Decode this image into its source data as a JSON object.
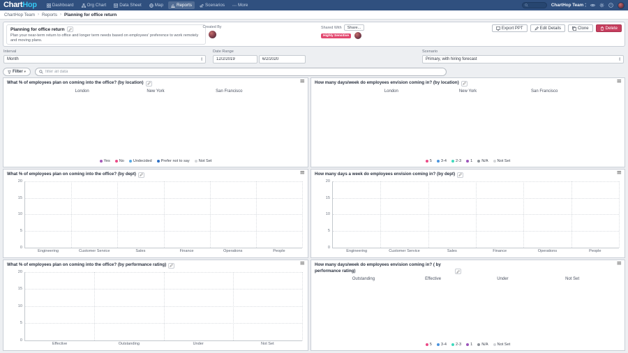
{
  "nav": {
    "logo_chart": "Chart",
    "logo_hop": "Hop",
    "items": [
      {
        "label": "Dashboard",
        "icon": "dashboard-icon"
      },
      {
        "label": "Org Chart",
        "icon": "org-chart-icon"
      },
      {
        "label": "Data Sheet",
        "icon": "data-sheet-icon"
      },
      {
        "label": "Map",
        "icon": "map-icon"
      },
      {
        "label": "Reports",
        "icon": "reports-icon"
      },
      {
        "label": "Scenarios",
        "icon": "scenarios-icon"
      },
      {
        "label": "More",
        "icon": "more-icon"
      }
    ],
    "active_item": "Reports",
    "team_name": "ChartHop Team",
    "right_icons": [
      "eye-icon",
      "gear-icon",
      "help-icon"
    ]
  },
  "breadcrumb": {
    "items": [
      "ChartHop Team",
      "Reports",
      "Planning for office return"
    ],
    "separator": "›"
  },
  "header": {
    "title": "Planning for office return",
    "description": "Plan your near-term return to office and longer term needs based on employees' preference to work remotely and moving plans.",
    "created_by_label": "Created By",
    "shared_with_label": "Shared With",
    "share_button": "Share...",
    "sensitive_badge": "Highly Sensitive",
    "buttons": [
      {
        "label": "Export PPT",
        "icon": "monitor",
        "style": "default"
      },
      {
        "label": "Edit Details",
        "icon": "pencil",
        "style": "default"
      },
      {
        "label": "Clone",
        "icon": "copy",
        "style": "default"
      },
      {
        "label": "Delete",
        "icon": "trash",
        "style": "danger"
      }
    ]
  },
  "controls": {
    "interval_label": "Interval",
    "interval_value": "Month",
    "date_range_label": "Date Range",
    "date_start": "12/2/2019",
    "date_end": "6/2/2020",
    "scenario_label": "Scenario",
    "scenario_value": "Primary, with hiring forecast"
  },
  "filter": {
    "button_label": "Filter",
    "button_icon": "funnel-icon",
    "search_icon": "magnifier-icon",
    "search_placeholder": "filter all data"
  },
  "legends": {
    "plan": [
      {
        "label": "Yes",
        "color": "#a55ab8"
      },
      {
        "label": "No",
        "color": "#ec4a86"
      },
      {
        "label": "Undecided",
        "color": "#58a9e4"
      },
      {
        "label": "Prefer not to say",
        "color": "#2d6fc4"
      },
      {
        "label": "Not Set",
        "color": "#d3d5d8"
      }
    ],
    "days": [
      {
        "label": "5",
        "color": "#ec4a86"
      },
      {
        "label": "3-4",
        "color": "#4b94de"
      },
      {
        "label": "2-3",
        "color": "#3fd9bd"
      },
      {
        "label": "1",
        "color": "#9c54ba"
      },
      {
        "label": "N/A",
        "color": "#8f949b"
      },
      {
        "label": "Not Set",
        "color": "#d3d5d8"
      }
    ]
  },
  "charts": [
    {
      "title": "What % of employees plan on coming into the office? (by location)",
      "kind": "columns",
      "columns": [
        "London",
        "New York",
        "San Francisco"
      ],
      "legend": "plan"
    },
    {
      "title": "How many days/week do employees envision coming in? (by location)",
      "kind": "columns",
      "columns": [
        "London",
        "New York",
        "San Francisco"
      ],
      "legend": "days"
    },
    {
      "title": "What % of employees plan on coming into the office? (by dept)",
      "kind": "axes",
      "yticks": [
        20,
        15,
        10,
        5,
        0
      ],
      "categories": [
        "Engineering",
        "Customer Service",
        "Sales",
        "Finance",
        "Operations",
        "People"
      ]
    },
    {
      "title": "How many days a week do employees envision coming in? (by dept)",
      "kind": "axes",
      "yticks": [
        20,
        15,
        10,
        5,
        0
      ],
      "categories": [
        "Engineering",
        "Customer Service",
        "Sales",
        "Finance",
        "Operations",
        "People"
      ]
    },
    {
      "title": "What % of employees plan on coming into the office? (by performance rating)",
      "kind": "axes",
      "yticks": [
        20,
        15,
        10,
        5,
        0
      ],
      "categories": [
        "Effective",
        "Outstanding",
        "Under",
        "Not Set"
      ]
    },
    {
      "title": "How many days/week do employees envision coming in? ( by performance rating)",
      "kind": "columns",
      "columns": [
        "Outstanding",
        "Effective",
        "Under",
        "Not Set"
      ],
      "legend": "days"
    }
  ],
  "chart_data": [
    {
      "type": "bar",
      "title": "What % of employees plan on coming into the office? (by location)",
      "categories": [
        "London",
        "New York",
        "San Francisco"
      ],
      "series": [],
      "legend": [
        "Yes",
        "No",
        "Undecided",
        "Prefer not to say",
        "Not Set"
      ],
      "legend_position": "bottom"
    },
    {
      "type": "bar",
      "title": "How many days/week do employees envision coming in? (by location)",
      "categories": [
        "London",
        "New York",
        "San Francisco"
      ],
      "series": [],
      "legend": [
        "5",
        "3-4",
        "2-3",
        "1",
        "N/A",
        "Not Set"
      ],
      "legend_position": "bottom"
    },
    {
      "type": "bar",
      "title": "What % of employees plan on coming into the office? (by dept)",
      "categories": [
        "Engineering",
        "Customer Service",
        "Sales",
        "Finance",
        "Operations",
        "People"
      ],
      "values": [],
      "ylim": [
        0,
        20
      ],
      "grid": true
    },
    {
      "type": "bar",
      "title": "How many days a week do employees envision coming in? (by dept)",
      "categories": [
        "Engineering",
        "Customer Service",
        "Sales",
        "Finance",
        "Operations",
        "People"
      ],
      "values": [],
      "ylim": [
        0,
        20
      ],
      "grid": true
    },
    {
      "type": "bar",
      "title": "What % of employees plan on coming into the office? (by performance rating)",
      "categories": [
        "Effective",
        "Outstanding",
        "Under",
        "Not Set"
      ],
      "values": [],
      "ylim": [
        0,
        20
      ],
      "grid": true
    },
    {
      "type": "bar",
      "title": "How many days/week do employees envision coming in? ( by performance rating)",
      "categories": [
        "Outstanding",
        "Effective",
        "Under",
        "Not Set"
      ],
      "series": [],
      "legend": [
        "5",
        "3-4",
        "2-3",
        "1",
        "N/A",
        "Not Set"
      ],
      "legend_position": "bottom"
    }
  ]
}
